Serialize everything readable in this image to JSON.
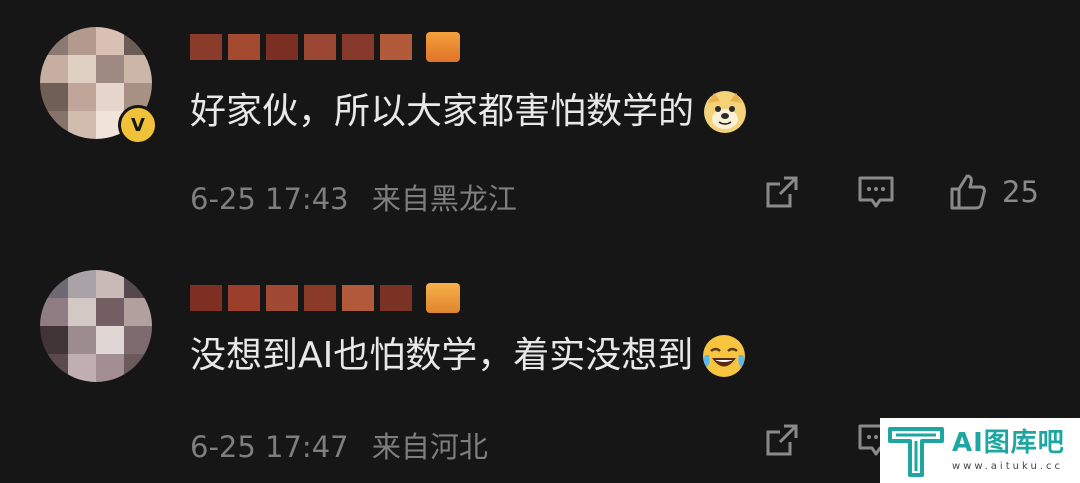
{
  "comments": [
    {
      "text": "好家伙，所以大家都害怕数学的",
      "emoji": "doge-emoji",
      "date": "6-25 17:43",
      "location": "来自黑龙江",
      "likes": "25",
      "avatar_colors": [
        "#8a7a72",
        "#b49a8d",
        "#d8c0b2",
        "#6b5d56",
        "#c6aea0",
        "#e0cfc3",
        "#9e8a80",
        "#ccb6a8",
        "#705f57",
        "#bfa698",
        "#e6d6cb",
        "#a79185",
        "#86746b",
        "#d2bcae",
        "#f0e3da",
        "#b89f92"
      ]
    },
    {
      "text": "没想到AI也怕数学，着实没想到",
      "emoji": "laugh-cry-emoji",
      "date": "6-25 17:47",
      "location": "来自河北",
      "likes": "",
      "avatar_colors": [
        "#6f6a72",
        "#a9a2a6",
        "#c9b9b7",
        "#54484c",
        "#8f7d83",
        "#d4c8c4",
        "#735e63",
        "#b2a09f",
        "#403437",
        "#9c8c8f",
        "#e1d7d4",
        "#7e6b6f",
        "#5a4a4e",
        "#c0aeb0",
        "#a38f93",
        "#6a5a5c"
      ]
    }
  ],
  "colors": {
    "background": "#161616",
    "text": "#e8e8e8",
    "meta": "#7e7e7e",
    "badge": "#f0c23a",
    "watermark_accent": "#1fa6a3"
  },
  "watermark": {
    "title": "AI图库吧",
    "url": "www.aituku.cc"
  }
}
